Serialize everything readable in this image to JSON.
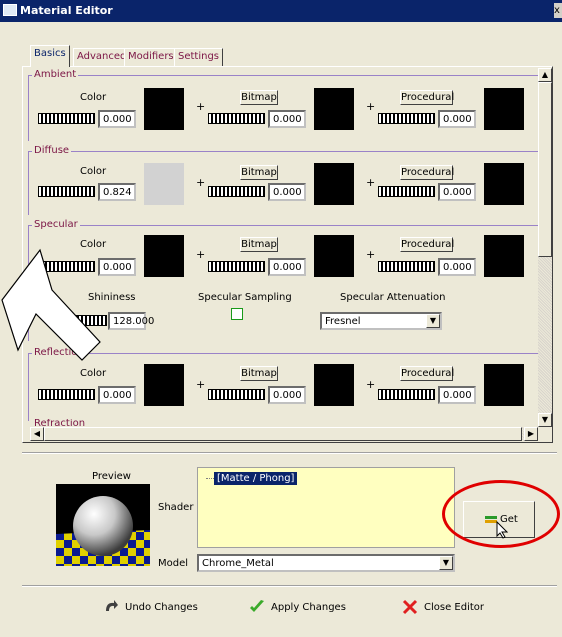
{
  "window": {
    "title": "Material Editor",
    "close_glyph": "x"
  },
  "tabs": [
    {
      "label": "Basics",
      "active": true
    },
    {
      "label": "Advanced",
      "active": false
    },
    {
      "label": "Modifiers",
      "active": false
    },
    {
      "label": "Settings",
      "active": false
    }
  ],
  "sections": {
    "ambient": {
      "title": "Ambient",
      "color_label": "Color",
      "bitmap_label": "Bitmap",
      "procedural_label": "Procedural",
      "color_value": "0.000",
      "bitmap_value": "0.000",
      "procedural_value": "0.000"
    },
    "diffuse": {
      "title": "Diffuse",
      "color_label": "Color",
      "bitmap_label": "Bitmap",
      "procedural_label": "Procedural",
      "color_value": "0.824",
      "bitmap_value": "0.000",
      "procedural_value": "0.000"
    },
    "specular": {
      "title": "Specular",
      "color_label": "Color",
      "bitmap_label": "Bitmap",
      "procedural_label": "Procedural",
      "color_value": "0.000",
      "bitmap_value": "0.000",
      "procedural_value": "0.000",
      "shininess_label": "Shininess",
      "shininess_value": "128.000",
      "sampling_label": "Specular Sampling",
      "attenuation_label": "Specular Attenuation",
      "attenuation_value": "Fresnel"
    },
    "reflection": {
      "title": "Reflection",
      "color_label": "Color",
      "bitmap_label": "Bitmap",
      "procedural_label": "Procedural",
      "color_value": "0.000",
      "bitmap_value": "0.000",
      "procedural_value": "0.000"
    },
    "refraction": {
      "title": "Refraction"
    }
  },
  "plus": "+",
  "preview": {
    "label": "Preview",
    "shader_label": "Shader",
    "shader_selected": "[Matte / Phong]",
    "model_label": "Model",
    "model_value": "Chrome_Metal",
    "get_label": "Get"
  },
  "footer": {
    "undo": "Undo Changes",
    "apply": "Apply Changes",
    "close": "Close Editor"
  },
  "colors": {
    "swatch_black": "#000000",
    "swatch_diffuse": "#d2d2d2",
    "highlight": "#e00000"
  },
  "icons": [
    "undo-arrow-icon",
    "check-icon",
    "close-x-icon",
    "get-arrow-icon",
    "mouse-cursor-icon"
  ]
}
